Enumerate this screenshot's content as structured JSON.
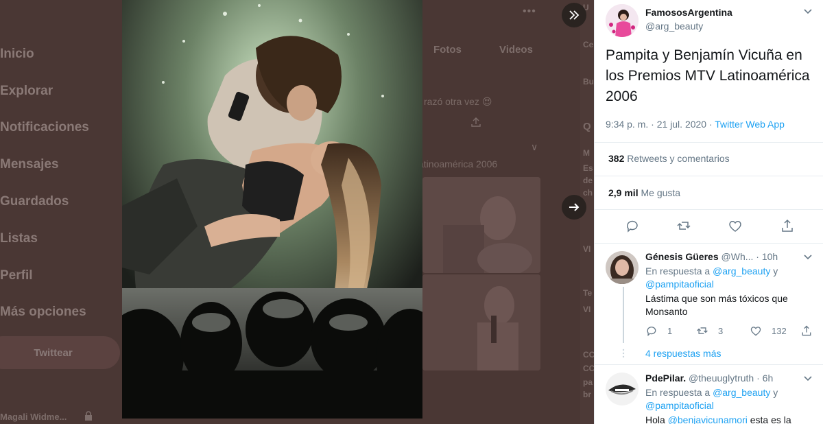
{
  "background": {
    "nav": [
      "Inicio",
      "Explorar",
      "Notificaciones",
      "Mensajes",
      "Guardados",
      "Listas",
      "Perfil",
      "Más opciones"
    ],
    "tweet_button": "Twittear",
    "account_name": "Magali Widme...",
    "tabs": [
      "Fotos",
      "Videos"
    ],
    "snippet_1": "razó otra vez 😍",
    "snippet_2": "atinoamérica 2006"
  },
  "overlay": {
    "collapse_icon": "double-chevron-right-icon",
    "next_icon": "arrow-right-icon"
  },
  "tweet": {
    "display_name": "FamososArgentina",
    "handle": "@arg_beauty",
    "text": "Pampita y Benjamín Vicuña en los Premios MTV Latinoamérica 2006",
    "time": "9:34 p. m. · 21 jul. 2020 · ",
    "source": "Twitter Web App",
    "retweets_count": "382",
    "retweets_label": "Retweets y comentarios",
    "likes_count": "2,9 mil",
    "likes_label": "Me gusta"
  },
  "replies": [
    {
      "name": "Génesis Güeres",
      "handle": "@Wh...",
      "time": "10h",
      "in_reply_prefix": "En respuesta a ",
      "to_1": "@arg_beauty",
      "and": " y ",
      "to_2": "@pampitaoficial",
      "text": "Lástima que son más tóxicos que Monsanto",
      "reply_count": "1",
      "retweet_count": "3",
      "like_count": "132",
      "more": "4 respuestas más"
    },
    {
      "name": "PdePilar.",
      "handle": "@theuuglytruth",
      "time": "6h",
      "in_reply_prefix": "En respuesta a ",
      "to_1": "@arg_beauty",
      "and": " y ",
      "to_2": "@pampitaoficial",
      "text_prefix": "Hola ",
      "mention": "@benjavicunamori",
      "text_suffix": " esta es la"
    }
  ],
  "colors": {
    "accent": "#1da1f2",
    "text": "#14171a",
    "muted": "#657786",
    "dim_bg": "#4a3734"
  }
}
